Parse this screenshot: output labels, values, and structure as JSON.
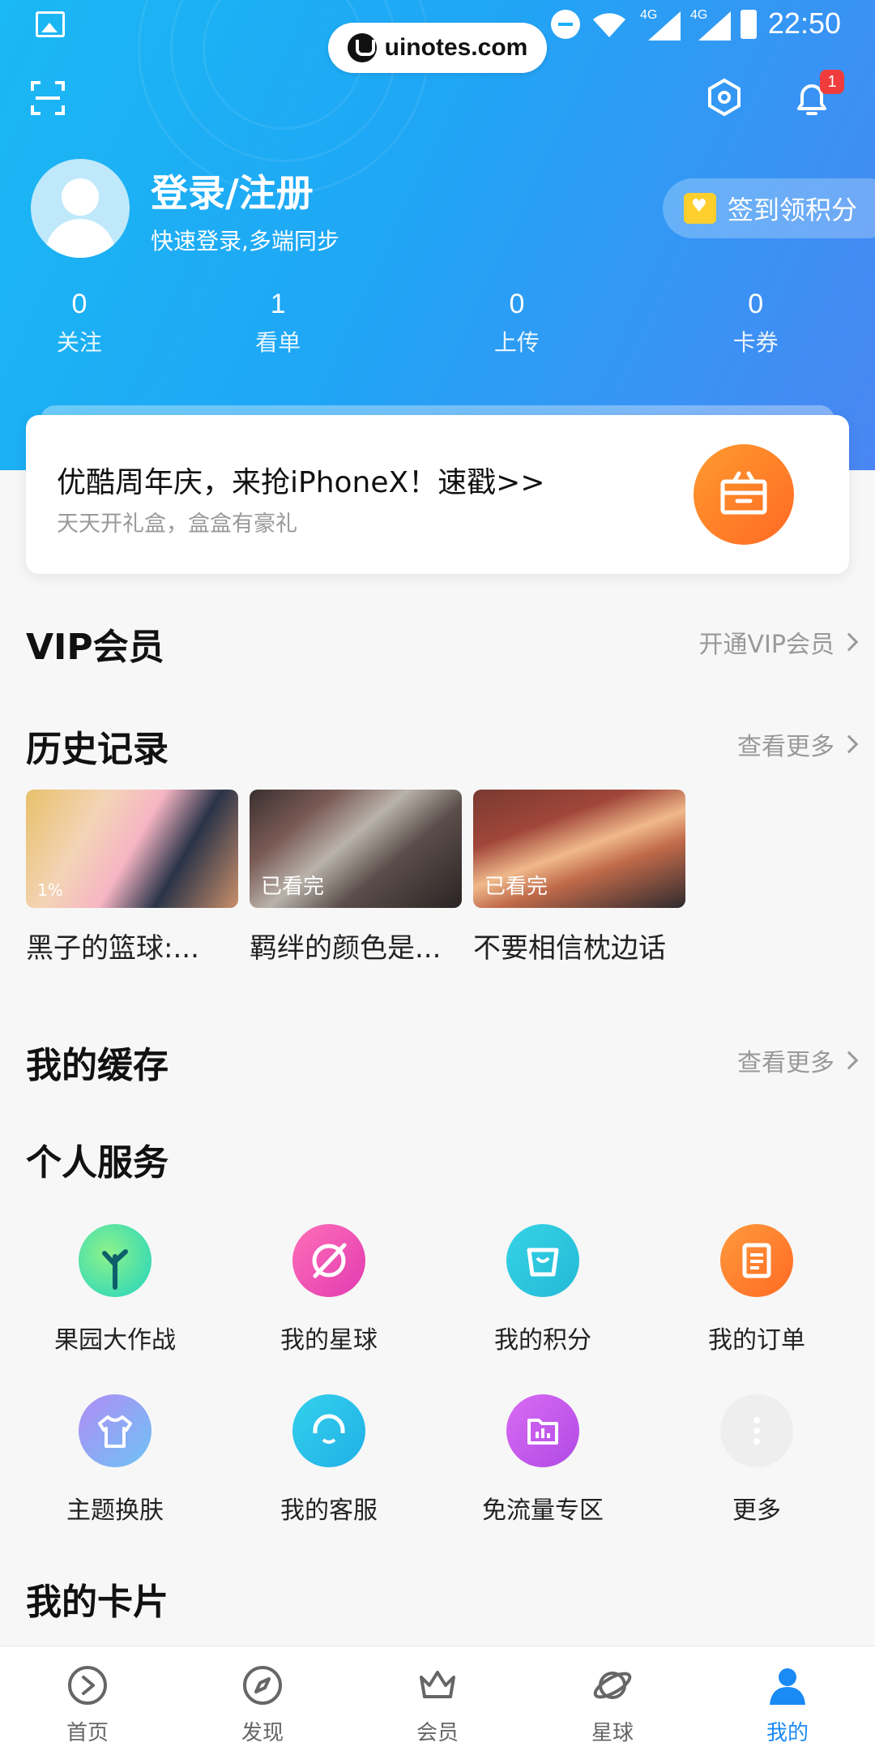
{
  "status_bar": {
    "time": "22:50",
    "network_1": "4G",
    "network_2": "4G"
  },
  "watermark": {
    "text": "uinotes.com"
  },
  "header": {
    "notification_badge": "1",
    "login_title": "登录/注册",
    "login_subtitle": "快速登录,多端同步",
    "checkin_label": "签到领积分",
    "stats": [
      {
        "value": "0",
        "label": "关注"
      },
      {
        "value": "1",
        "label": "看单"
      },
      {
        "value": "0",
        "label": "上传"
      },
      {
        "value": "0",
        "label": "卡券"
      }
    ]
  },
  "promo": {
    "title": "优酷周年庆，来抢iPhoneX！速戳>>",
    "subtitle": "天天开礼盒，盒盒有豪礼"
  },
  "vip": {
    "title": "VIP会员",
    "link": "开通VIP会员"
  },
  "history": {
    "title": "历史记录",
    "link": "查看更多",
    "items": [
      {
        "title": "黑子的篮球:...",
        "progress": "1%"
      },
      {
        "title": "羁绊的颜色是...",
        "progress": "已看完"
      },
      {
        "title": "不要相信枕边话",
        "progress": "已看完"
      }
    ]
  },
  "cache": {
    "title": "我的缓存",
    "link": "查看更多"
  },
  "services": {
    "title": "个人服务",
    "items": [
      {
        "label": "果园大作战",
        "icon": "tree-icon",
        "color": "#1fd3c0"
      },
      {
        "label": "我的星球",
        "icon": "planet-icon",
        "color": "#f052b8"
      },
      {
        "label": "我的积分",
        "icon": "shopping-bag-icon",
        "color": "#27c6df"
      },
      {
        "label": "我的订单",
        "icon": "document-icon",
        "color": "#ff7f2e"
      },
      {
        "label": "主题换肤",
        "icon": "tshirt-icon",
        "color": "#8aa6f8"
      },
      {
        "label": "我的客服",
        "icon": "headset-icon",
        "color": "#23bfe8"
      },
      {
        "label": "免流量专区",
        "icon": "folder-chart-icon",
        "color": "#c45ef0"
      },
      {
        "label": "更多",
        "icon": "more-dots-icon",
        "color": "#eeeeee"
      }
    ]
  },
  "cards": {
    "title": "我的卡片"
  },
  "tabbar": {
    "items": [
      {
        "label": "首页",
        "icon": "play-circle-icon"
      },
      {
        "label": "发现",
        "icon": "compass-icon"
      },
      {
        "label": "会员",
        "icon": "crown-icon"
      },
      {
        "label": "星球",
        "icon": "planet-icon"
      },
      {
        "label": "我的",
        "icon": "user-icon",
        "active": true
      }
    ]
  },
  "colors": {
    "accent": "#1a8af4",
    "header_start": "#1ab8f4",
    "header_end": "#4a86f3",
    "promo_button": "#ff7a28"
  }
}
